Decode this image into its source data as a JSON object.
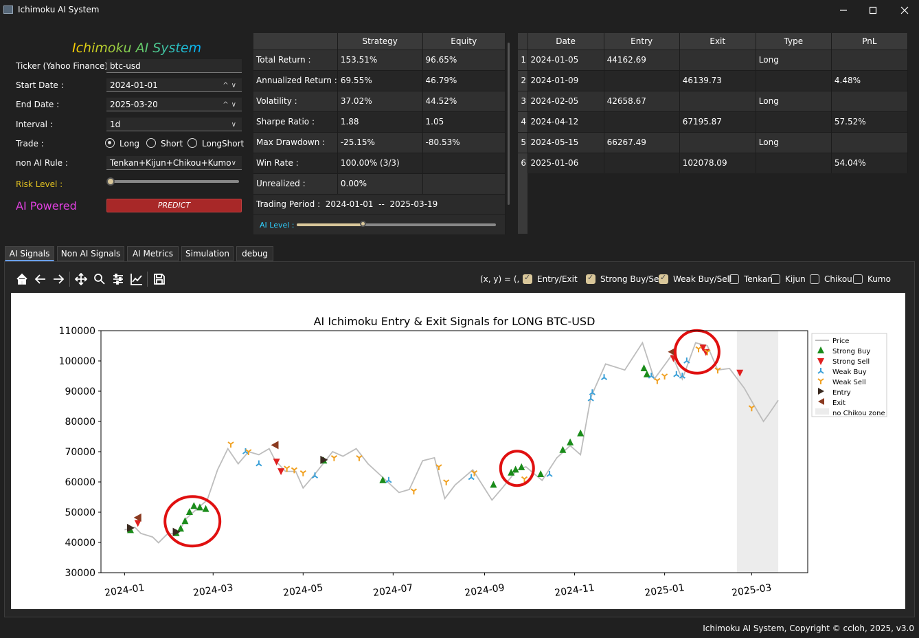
{
  "window": {
    "title": "Ichimoku AI System"
  },
  "settings": {
    "app_title": "Ichimoku AI System",
    "ticker_label": "Ticker (Yahoo Finance) :",
    "ticker_value": "btc-usd",
    "start_label": "Start Date :",
    "start_value": "2024-01-01",
    "end_label": "End Date :",
    "end_value": "2025-03-20",
    "interval_label": "Interval :",
    "interval_value": "1d",
    "trade_label": "Trade :",
    "trade_options": [
      "Long",
      "Short",
      "LongShort"
    ],
    "trade_selected": "Long",
    "rule_label": "non AI Rule :",
    "rule_value": "Tenkan+Kijun+Chikou+Kumo",
    "risk_label": "Risk Level :",
    "risk_level": 0.0,
    "ai_powered": "AI Powered",
    "predict": "PREDICT",
    "colors": {
      "risk": "#e0c020",
      "ai_powered": "#e040e0",
      "predict": "#a82828"
    }
  },
  "stats": {
    "headers": [
      "",
      "Strategy",
      "Equity"
    ],
    "rows": [
      [
        "Total Return :",
        "153.51%",
        "96.65%"
      ],
      [
        "Annualized Return :",
        "69.55%",
        "46.79%"
      ],
      [
        "Volatility :",
        "37.02%",
        "44.52%"
      ],
      [
        "Sharpe Ratio :",
        "1.88",
        "1.05"
      ],
      [
        "Max Drawdown :",
        "-25.15%",
        "-80.53%"
      ],
      [
        "Win Rate :",
        "100.00% (3/3)",
        ""
      ],
      [
        "Unrealized :",
        "0.00%",
        ""
      ]
    ],
    "period_label": "Trading Period :",
    "period_start": "2024-01-01",
    "period_sep": "--",
    "period_end": "2025-03-19",
    "ai_level_label": "AI Level :",
    "ai_level": 0.33
  },
  "trades": {
    "headers": [
      "Date",
      "Entry",
      "Exit",
      "Type",
      "PnL"
    ],
    "rows": [
      [
        "1",
        "2024-01-05",
        "44162.69",
        "",
        "Long",
        ""
      ],
      [
        "2",
        "2024-01-09",
        "",
        "46139.73",
        "",
        "4.48%"
      ],
      [
        "3",
        "2024-02-05",
        "42658.67",
        "",
        "Long",
        ""
      ],
      [
        "4",
        "2024-04-12",
        "",
        "67195.87",
        "",
        "57.52%"
      ],
      [
        "5",
        "2024-05-15",
        "66267.49",
        "",
        "Long",
        ""
      ],
      [
        "6",
        "2025-01-06",
        "",
        "102078.09",
        "",
        "54.04%"
      ]
    ]
  },
  "tabs": [
    "AI Signals",
    "Non AI Signals",
    "AI Metrics",
    "Simulation",
    "debug"
  ],
  "toolbar": {
    "icons": [
      "home-icon",
      "back-icon",
      "forward-icon",
      "pan-icon",
      "zoom-icon",
      "configure-icon",
      "edit-axes-icon",
      "save-icon"
    ],
    "coord_readout": "(x, y) = (, )",
    "checks": [
      {
        "label": "Entry/Exit",
        "checked": true
      },
      {
        "label": "Strong Buy/Sell",
        "checked": true
      },
      {
        "label": "Weak Buy/Sell",
        "checked": true
      },
      {
        "label": "Tenkan",
        "checked": false
      },
      {
        "label": "Kijun",
        "checked": false
      },
      {
        "label": "Chikou",
        "checked": false
      },
      {
        "label": "Kumo",
        "checked": false
      }
    ]
  },
  "chart_data": {
    "type": "line",
    "title": "AI Ichimoku Entry & Exit Signals for LONG BTC-USD",
    "xlabel": "",
    "ylabel": "",
    "ylim": [
      30000,
      110000
    ],
    "xlim": [
      "2023-12-16",
      "2025-04-08"
    ],
    "yticks": [
      30000,
      40000,
      50000,
      60000,
      70000,
      80000,
      90000,
      100000,
      110000
    ],
    "xticks": [
      "2024-01",
      "2024-03",
      "2024-05",
      "2024-07",
      "2024-09",
      "2024-11",
      "2025-01",
      "2025-03"
    ],
    "legend_position": "outside-right",
    "legend": [
      "Price",
      "Strong Buy",
      "Strong Sell",
      "Weak Buy",
      "Weak Sell",
      "Entry",
      "Exit",
      "no Chikou zone"
    ],
    "no_chikou_zone": [
      "2025-02-19",
      "2025-03-19"
    ],
    "price": [
      [
        "2024-01-01",
        44200
      ],
      [
        "2024-01-08",
        45000
      ],
      [
        "2024-01-12",
        43000
      ],
      [
        "2024-01-20",
        41800
      ],
      [
        "2024-01-24",
        39900
      ],
      [
        "2024-01-30",
        42800
      ],
      [
        "2024-02-06",
        43000
      ],
      [
        "2024-02-12",
        48000
      ],
      [
        "2024-02-20",
        51500
      ],
      [
        "2024-02-26",
        54000
      ],
      [
        "2024-03-04",
        64000
      ],
      [
        "2024-03-11",
        71000
      ],
      [
        "2024-03-18",
        66000
      ],
      [
        "2024-03-25",
        70000
      ],
      [
        "2024-04-01",
        69000
      ],
      [
        "2024-04-08",
        71000
      ],
      [
        "2024-04-12",
        67200
      ],
      [
        "2024-04-19",
        63500
      ],
      [
        "2024-04-26",
        63500
      ],
      [
        "2024-05-01",
        58000
      ],
      [
        "2024-05-08",
        62000
      ],
      [
        "2024-05-15",
        66300
      ],
      [
        "2024-05-21",
        70000
      ],
      [
        "2024-05-28",
        68500
      ],
      [
        "2024-06-06",
        71000
      ],
      [
        "2024-06-14",
        66000
      ],
      [
        "2024-06-24",
        61500
      ],
      [
        "2024-07-05",
        56500
      ],
      [
        "2024-07-12",
        57500
      ],
      [
        "2024-07-21",
        67000
      ],
      [
        "2024-07-29",
        68000
      ],
      [
        "2024-08-05",
        54500
      ],
      [
        "2024-08-12",
        59000
      ],
      [
        "2024-08-24",
        64000
      ],
      [
        "2024-09-06",
        54000
      ],
      [
        "2024-09-13",
        58000
      ],
      [
        "2024-09-23",
        64000
      ],
      [
        "2024-09-29",
        65000
      ],
      [
        "2024-10-10",
        60500
      ],
      [
        "2024-10-20",
        68000
      ],
      [
        "2024-10-29",
        72000
      ],
      [
        "2024-11-05",
        69000
      ],
      [
        "2024-11-12",
        88000
      ],
      [
        "2024-11-22",
        99000
      ],
      [
        "2024-12-05",
        97000
      ],
      [
        "2024-12-17",
        106000
      ],
      [
        "2024-12-25",
        94000
      ],
      [
        "2025-01-06",
        102000
      ],
      [
        "2025-01-13",
        94000
      ],
      [
        "2025-01-22",
        106000
      ],
      [
        "2025-01-30",
        105000
      ],
      [
        "2025-02-06",
        97000
      ],
      [
        "2025-02-14",
        97500
      ],
      [
        "2025-02-24",
        91000
      ],
      [
        "2025-03-03",
        85000
      ],
      [
        "2025-03-09",
        80000
      ],
      [
        "2025-03-12",
        82000
      ],
      [
        "2025-03-19",
        87000
      ]
    ],
    "strong_buy": [
      [
        "2024-01-05",
        44000
      ],
      [
        "2024-02-05",
        43000
      ],
      [
        "2024-02-08",
        44500
      ],
      [
        "2024-02-11",
        47000
      ],
      [
        "2024-02-14",
        50000
      ],
      [
        "2024-02-17",
        52000
      ],
      [
        "2024-02-21",
        51500
      ],
      [
        "2024-02-25",
        51000
      ],
      [
        "2024-05-15",
        67000
      ],
      [
        "2024-06-24",
        60500
      ],
      [
        "2024-09-07",
        59000
      ],
      [
        "2024-09-19",
        63000
      ],
      [
        "2024-09-22",
        64000
      ],
      [
        "2024-09-26",
        64800
      ],
      [
        "2024-10-09",
        62500
      ],
      [
        "2024-10-24",
        70500
      ],
      [
        "2024-10-29",
        73000
      ],
      [
        "2024-11-05",
        76000
      ],
      [
        "2024-12-18",
        97500
      ],
      [
        "2024-12-20",
        95500
      ]
    ],
    "strong_sell": [
      [
        "2024-01-10",
        46500
      ],
      [
        "2024-04-13",
        66800
      ],
      [
        "2024-04-16",
        63600
      ],
      [
        "2025-01-07",
        101000
      ],
      [
        "2025-01-27",
        104500
      ],
      [
        "2025-01-29",
        103000
      ],
      [
        "2025-02-21",
        96200
      ]
    ],
    "weak_buy": [
      [
        "2024-03-23",
        70000
      ],
      [
        "2024-04-01",
        66000
      ],
      [
        "2024-05-09",
        62000
      ],
      [
        "2024-06-28",
        60500
      ],
      [
        "2024-08-23",
        61500
      ],
      [
        "2024-10-15",
        62500
      ],
      [
        "2024-11-12",
        87500
      ],
      [
        "2024-11-13",
        89500
      ],
      [
        "2024-11-21",
        94500
      ],
      [
        "2024-12-23",
        95000
      ],
      [
        "2025-01-09",
        95500
      ],
      [
        "2025-01-13",
        95000
      ],
      [
        "2025-01-16",
        100000
      ]
    ],
    "weak_sell": [
      [
        "2024-03-13",
        72500
      ],
      [
        "2024-03-25",
        70000
      ],
      [
        "2024-04-20",
        64500
      ],
      [
        "2024-04-25",
        64000
      ],
      [
        "2024-05-01",
        63000
      ],
      [
        "2024-05-22",
        68000
      ],
      [
        "2024-06-08",
        68000
      ],
      [
        "2024-07-15",
        57000
      ],
      [
        "2024-08-01",
        65000
      ],
      [
        "2024-08-06",
        60000
      ],
      [
        "2024-08-25",
        63000
      ],
      [
        "2024-09-28",
        61000
      ],
      [
        "2024-12-27",
        93500
      ],
      [
        "2025-01-01",
        95000
      ],
      [
        "2025-01-24",
        104000
      ],
      [
        "2025-01-30",
        103000
      ],
      [
        "2025-02-06",
        97000
      ],
      [
        "2025-03-01",
        84500
      ]
    ],
    "entry": [
      [
        "2024-01-05",
        44800
      ],
      [
        "2024-02-05",
        43500
      ],
      [
        "2024-05-15",
        67300
      ]
    ],
    "exit": [
      [
        "2024-01-10",
        48200
      ],
      [
        "2024-04-12",
        72200
      ],
      [
        "2025-01-06",
        103000
      ]
    ],
    "annotation_circles": [
      {
        "center": [
          "2024-02-16",
          47000
        ],
        "label": ""
      },
      {
        "center": [
          "2024-09-23",
          64500
        ],
        "label": ""
      },
      {
        "center": [
          "2025-01-23",
          103000
        ],
        "label": ""
      }
    ],
    "colors": {
      "price": "#bdbdbd",
      "strong_buy": "#1a8c1a",
      "strong_sell": "#e02020",
      "weak_buy": "#3aa0d8",
      "weak_sell": "#f0a020",
      "entry": "#3a2a20",
      "exit": "#8b3a20",
      "zone": "#ececec",
      "annotation": "#e01010"
    }
  },
  "footer": "Ichimoku AI System, Copyright © ccloh, 2025, v3.0"
}
